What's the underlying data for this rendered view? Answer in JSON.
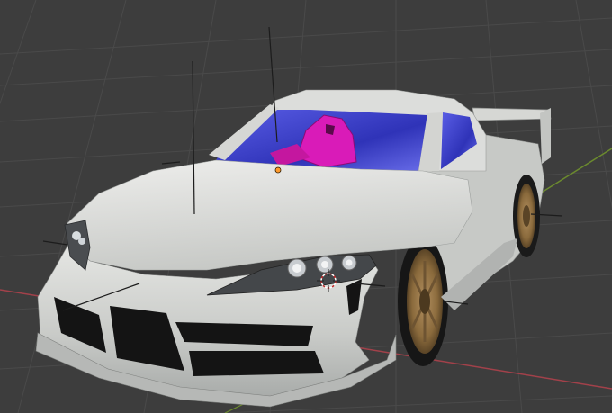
{
  "viewport": {
    "background": "#3d3d3d",
    "grid_color": "#4a4a4a",
    "x_axis_color": "#a2414a",
    "y_axis_color": "#6b8a2e"
  },
  "model": {
    "body_color": "#d2d3d0",
    "body_shadow": "#9ea19f",
    "glass_color": "#3b3fc9",
    "seat_color": "#d91bb8",
    "wheel_color": "#9a7a4a",
    "tire_color": "#1a1a1a",
    "grille_color": "#141414",
    "origin_dot_color": "#ff9b2e"
  },
  "icons": {
    "origin": "origin-dot-icon",
    "cursor": "3d-cursor-icon"
  }
}
